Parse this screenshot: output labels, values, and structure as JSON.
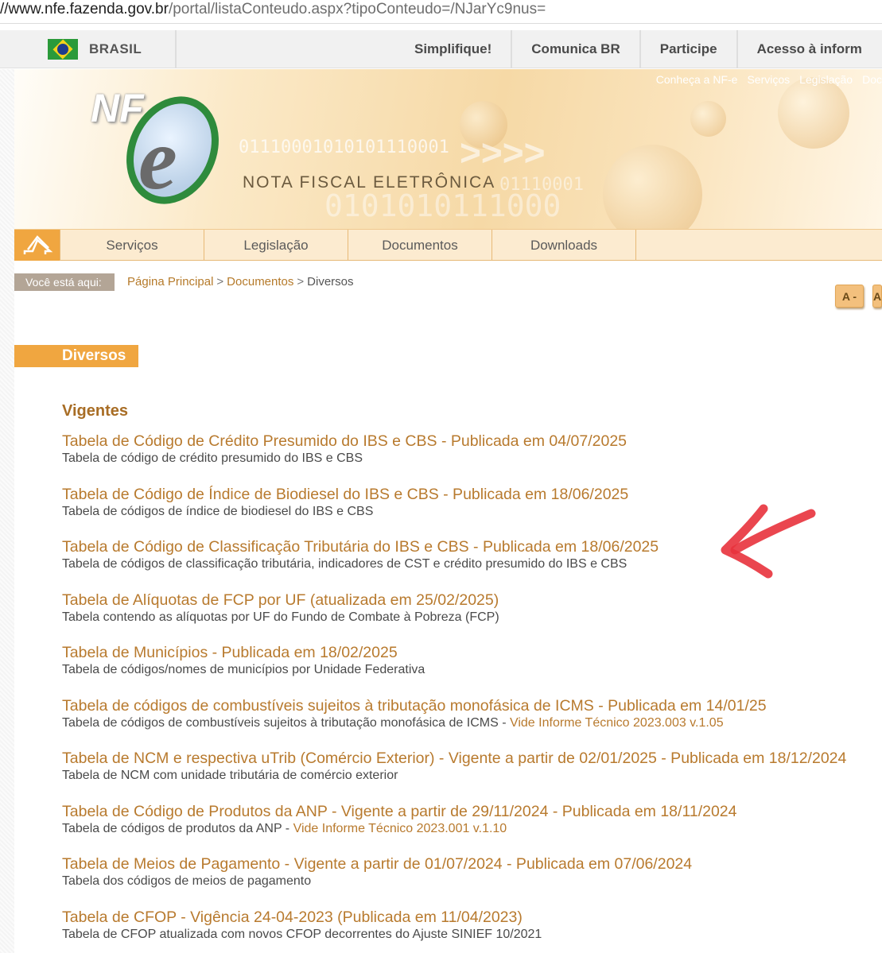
{
  "url": {
    "host": "//www.nfe.fazenda.gov.br",
    "path": "/portal/listaConteudo.aspx?tipoConteudo=/NJarYc9nus="
  },
  "govbar": {
    "brasil": "BRASIL",
    "links": [
      "Simplifique!",
      "Comunica BR",
      "Participe",
      "Acesso à inform"
    ]
  },
  "banner": {
    "logo_text": "NF",
    "logo_letter": "e",
    "tagline": "NOTA FISCAL ELETRÔNICA",
    "top_links": [
      "Conheça a NF-e",
      "Serviços",
      "Legislação",
      "Doc"
    ],
    "binary_1": "01110001010101110001",
    "binary_2": "01110001",
    "binary_3": "0101010111000"
  },
  "nav": {
    "items": [
      "Serviços",
      "Legislação",
      "Documentos",
      "Downloads"
    ]
  },
  "breadcrumb": {
    "label": "Você está aqui:",
    "home": "Página Principal",
    "section": "Documentos",
    "current": "Diversos",
    "sep": ">"
  },
  "font_buttons": {
    "decrease": "A -",
    "increase": "A"
  },
  "section_title": "Diversos",
  "group_title": "Vigentes",
  "entries": [
    {
      "title": "Tabela de Código de Crédito Presumido do IBS e CBS - Publicada em 04/07/2025",
      "desc": "Tabela de código de crédito presumido do IBS e CBS",
      "link": ""
    },
    {
      "title": "Tabela de Código de Índice de Biodiesel do IBS e CBS - Publicada em 18/06/2025",
      "desc": "Tabela de códigos de índice de biodiesel do IBS e CBS",
      "link": ""
    },
    {
      "title": "Tabela de Código de Classificação Tributária do IBS e CBS - Publicada em 18/06/2025",
      "desc": "Tabela de códigos de classificação tributária, indicadores de CST e crédito presumido do IBS e CBS",
      "link": ""
    },
    {
      "title": "Tabela de Alíquotas de FCP por UF (atualizada em 25/02/2025)",
      "desc": "Tabela contendo as alíquotas por UF do Fundo de Combate à Pobreza (FCP)",
      "link": ""
    },
    {
      "title": "Tabela de Municípios - Publicada em 18/02/2025",
      "desc": "Tabela de códigos/nomes de municípios por Unidade Federativa",
      "link": ""
    },
    {
      "title": "Tabela de códigos de combustíveis sujeitos à tributação monofásica de ICMS - Publicada em 14/01/25",
      "desc": "Tabela de códigos de combustíveis sujeitos à tributação monofásica de ICMS - ",
      "link": "Vide Informe Técnico 2023.003 v.1.05"
    },
    {
      "title": "Tabela de NCM e respectiva uTrib (Comércio Exterior) - Vigente a partir de 02/01/2025 - Publicada em 18/12/2024",
      "desc": "Tabela de NCM com unidade tributária de comércio exterior",
      "link": ""
    },
    {
      "title": "Tabela de Código de Produtos da ANP - Vigente a partir de 29/11/2024 - Publicada em 18/11/2024",
      "desc": "Tabela de códigos de produtos da ANP - ",
      "link": "Vide Informe Técnico 2023.001 v.1.10"
    },
    {
      "title": "Tabela de Meios de Pagamento - Vigente a partir de 01/07/2024 - Publicada em 07/06/2024",
      "desc": "Tabela dos códigos de meios de pagamento",
      "link": ""
    },
    {
      "title": "Tabela de CFOP - Vigência 24-04-2023 (Publicada em 11/04/2023)",
      "desc": "Tabela de CFOP atualizada com novos CFOP decorrentes do Ajuste SINIEF 10/2021",
      "link": ""
    }
  ],
  "colors": {
    "accent": "#f0a640",
    "link": "#b87a2e",
    "annotation_arrow": "#e8323c"
  },
  "icons": {
    "home": "home-icon",
    "flag": "brazil-flag-icon",
    "annotation": "red-arrow-annotation"
  }
}
